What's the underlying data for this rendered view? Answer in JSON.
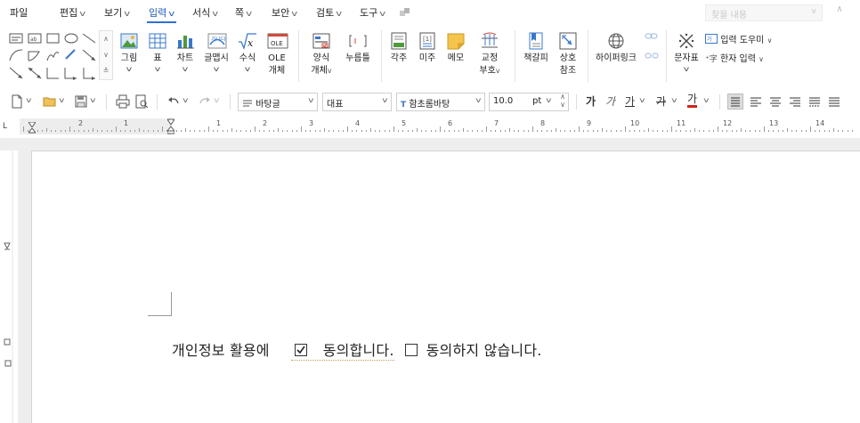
{
  "menubar": {
    "items": [
      {
        "label": "파일",
        "has_arrow": false
      },
      {
        "label": "편집",
        "has_arrow": true
      },
      {
        "label": "보기",
        "has_arrow": true
      },
      {
        "label": "입력",
        "has_arrow": true,
        "active": true
      },
      {
        "label": "서식",
        "has_arrow": true
      },
      {
        "label": "쪽",
        "has_arrow": true
      },
      {
        "label": "보안",
        "has_arrow": true
      },
      {
        "label": "검토",
        "has_arrow": true
      },
      {
        "label": "도구",
        "has_arrow": true
      }
    ],
    "search_placeholder": "찾을 내용"
  },
  "ribbon": {
    "picture": {
      "label": "그림"
    },
    "table": {
      "label": "표"
    },
    "chart": {
      "label": "차트"
    },
    "glyph_art": {
      "label": "글맵시"
    },
    "equation": {
      "label": "수식"
    },
    "ole": {
      "label1": "OLE",
      "label2": "개체"
    },
    "form_object": {
      "label1": "양식",
      "label2": "개체"
    },
    "click_here": {
      "label": "누름틀"
    },
    "footnote": {
      "label": "각주"
    },
    "endnote": {
      "label": "미주"
    },
    "memo": {
      "label": "메모"
    },
    "proofread": {
      "label1": "교정",
      "label2": "부호"
    },
    "bookmark": {
      "label": "책갈피"
    },
    "cross_ref": {
      "label1": "상호",
      "label2": "참조"
    },
    "hyperlink": {
      "label": "하이퍼링크"
    },
    "char_map": {
      "label": "문자표"
    },
    "input_helper": {
      "label": "입력 도우미"
    },
    "hanja_input": {
      "label": "한자 입력"
    }
  },
  "fmtbar": {
    "style": "바탕글",
    "language": "대표",
    "font": "함초롬바탕",
    "font_size": "10.0",
    "unit": "pt",
    "bold": "가",
    "italic": "가",
    "underline": "가",
    "strike": "가",
    "font_color": "가"
  },
  "ruler": {
    "numbers": [
      "2",
      "1",
      "1",
      "2",
      "3",
      "4",
      "5",
      "6",
      "7",
      "8",
      "9",
      "10",
      "11",
      "12",
      "13",
      "14"
    ],
    "corner": "L"
  },
  "document": {
    "part1": "개인정보 활용에",
    "checked_box": "☑",
    "part2": "동의합니다.",
    "unchecked_box": "☐",
    "part3": "동의하지 않습니다."
  },
  "colors": {
    "accent": "#2f6fd6",
    "doc_background": "#eeeeee",
    "ribbon_icon_blue": "#3a78c9",
    "ribbon_icon_green": "#4f9a3c",
    "ribbon_icon_yellow": "#e9b43f"
  }
}
